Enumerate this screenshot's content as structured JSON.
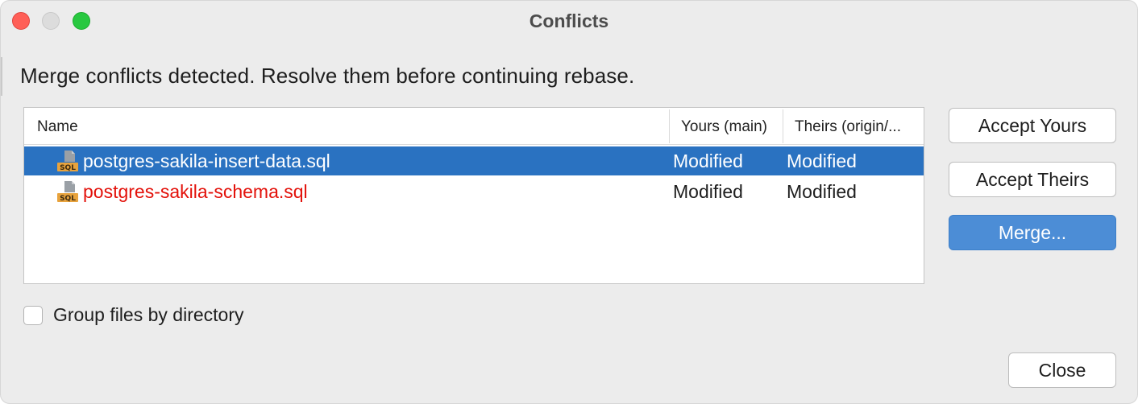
{
  "window": {
    "title": "Conflicts",
    "traffic_lights": {
      "close": "#ff5f57",
      "minimize": "#dcdcdc",
      "maximize": "#28c840"
    }
  },
  "message": "Merge conflicts detected. Resolve them before continuing rebase.",
  "table": {
    "columns": [
      "Name",
      "Yours (main)",
      "Theirs (origin/..."
    ],
    "rows": [
      {
        "icon": "sql-file-icon",
        "name": "postgres-sakila-insert-data.sql",
        "yours": "Modified",
        "theirs": "Modified",
        "selected": true
      },
      {
        "icon": "sql-file-icon",
        "name": "postgres-sakila-schema.sql",
        "yours": "Modified",
        "theirs": "Modified",
        "selected": false
      }
    ],
    "selection_color": "#2a72c1",
    "conflict_text_color": "#e3120b"
  },
  "buttons": {
    "accept_yours": "Accept Yours",
    "accept_theirs": "Accept Theirs",
    "merge": "Merge...",
    "close": "Close"
  },
  "group_by_directory": {
    "label": "Group files by directory",
    "checked": false
  }
}
